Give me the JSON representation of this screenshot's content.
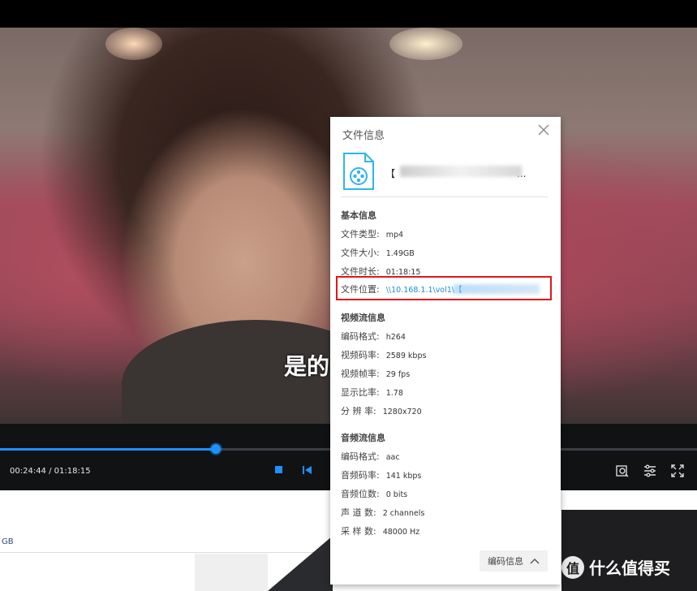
{
  "player": {
    "subtitle": "是的",
    "time_display": "00:24:44 / 01:18:15",
    "progress": 0.31,
    "colors": {
      "accent": "#1e90ff",
      "control_bg": "#101213"
    },
    "icons": [
      "stop-icon",
      "previous-icon",
      "snapshot-icon",
      "settings-icon",
      "fullscreen-icon"
    ]
  },
  "dialog": {
    "title": "文件信息",
    "close_icon": "close-icon",
    "file_name": "【",
    "file_name_suffix": "...",
    "basic": {
      "heading": "基本信息",
      "rows": [
        {
          "label": "文件类型:",
          "value": "mp4"
        },
        {
          "label": "文件大小:",
          "value": "1.49GB"
        },
        {
          "label": "文件时长:",
          "value": "01:18:15"
        },
        {
          "label": "文件位置:",
          "value": "\\\\10.168.1.1\\vol1\\【"
        }
      ]
    },
    "video": {
      "heading": "视频流信息",
      "rows": [
        {
          "label": "编码格式:",
          "value": "h264"
        },
        {
          "label": "视频码率:",
          "value": "2589 kbps"
        },
        {
          "label": "视频帧率:",
          "value": "29 fps"
        },
        {
          "label": "显示比率:",
          "value": "1.78"
        },
        {
          "label": "分 辨 率:",
          "value": "1280x720"
        }
      ]
    },
    "audio": {
      "heading": "音频流信息",
      "rows": [
        {
          "label": "编码格式:",
          "value": "aac"
        },
        {
          "label": "音频码率:",
          "value": "141 kbps"
        },
        {
          "label": "音频位数:",
          "value": "0 bits"
        },
        {
          "label": "声 道 数:",
          "value": "2 channels"
        },
        {
          "label": "采 样 数:",
          "value": "48000 Hz"
        }
      ]
    },
    "codec_button": "编码信息",
    "highlight_color": "#e0161c"
  },
  "background": {
    "partial_text": "GB",
    "watermark": "什么值得买",
    "watermark_badge": "值"
  }
}
